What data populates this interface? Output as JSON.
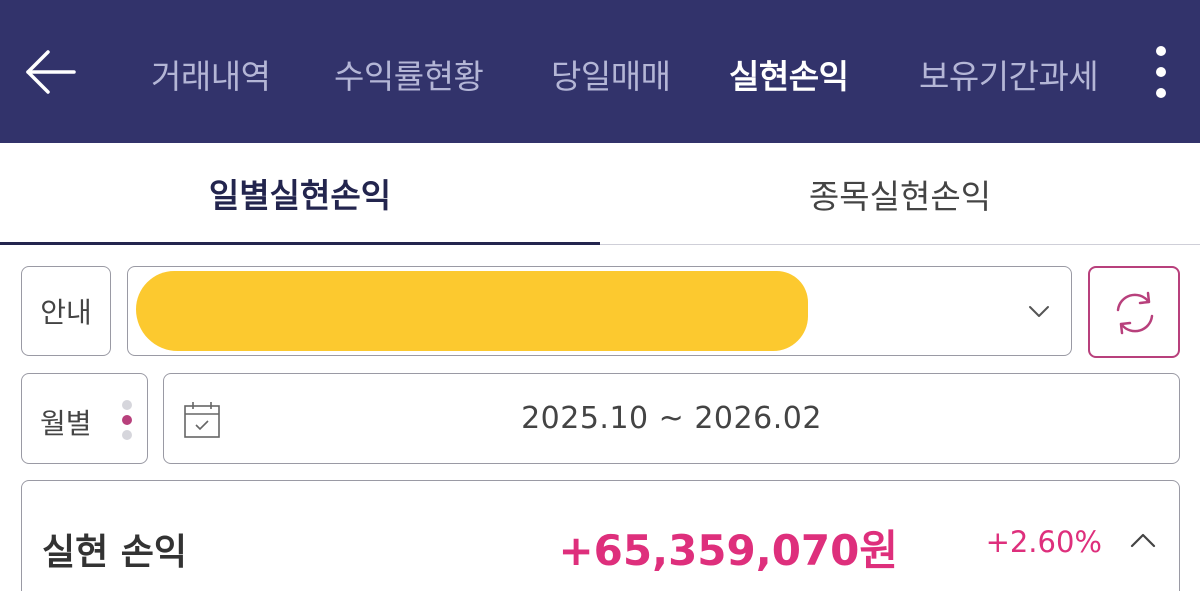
{
  "nav": {
    "back_icon": "arrow-left-icon",
    "tabs": [
      {
        "label": "거래내역",
        "active": false
      },
      {
        "label": "수익률현황",
        "active": false
      },
      {
        "label": "당일매매",
        "active": false
      },
      {
        "label": "실현손익",
        "active": true
      },
      {
        "label": "보유기간과세",
        "active": false
      }
    ],
    "more_icon": "more-vertical-icon"
  },
  "subtabs": [
    {
      "label": "일별실현손익",
      "active": true
    },
    {
      "label": "종목실현손익",
      "active": false
    }
  ],
  "filters": {
    "info_label": "안내",
    "account_masked": true,
    "refresh_icon": "refresh-icon",
    "period_label": "월별",
    "date_range": "2025.10 ~ 2026.02"
  },
  "summary": {
    "title": "실현 손익",
    "amount": "+65,359,070원",
    "rate": "+2.60%",
    "toggle_icon": "chevron-up-icon"
  },
  "colors": {
    "header_bg": "#32336b",
    "accent_pink": "#de2f7c",
    "refresh_border": "#b8407c",
    "mask_yellow": "#fcc92f"
  }
}
